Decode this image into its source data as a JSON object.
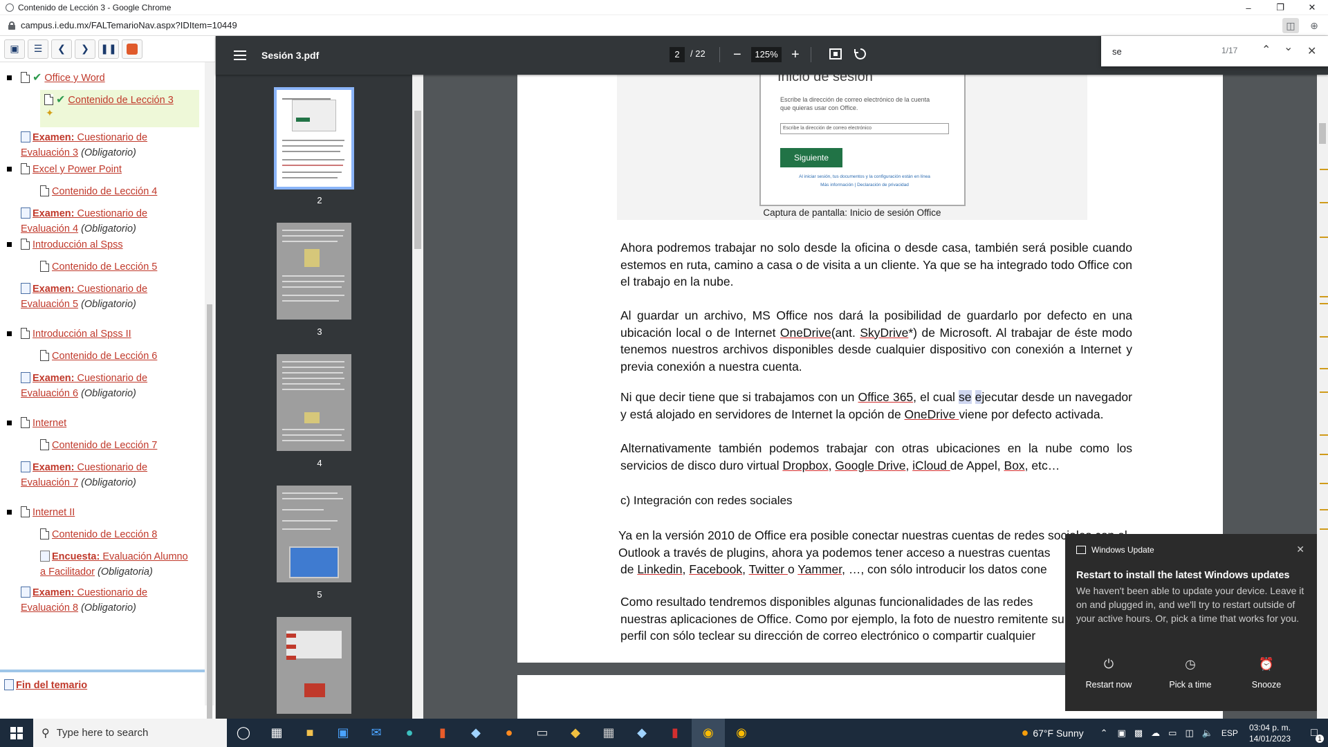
{
  "browser": {
    "window_title": "Contenido de Lección 3 - Google Chrome",
    "url": "campus.i.edu.mx/FALTemarioNav.aspx?IDItem=10449",
    "min_icon": "minimize-icon",
    "restore_icon": "restore-icon",
    "close_icon": "close-icon"
  },
  "left_panel": {
    "items": [
      {
        "title": "Office y Word"
      },
      {
        "title": "Contenido de Lección 3"
      },
      {
        "prefix": "Examen:",
        "rest1": " Cuestionario de",
        "rest2": "Evaluación 3",
        "tag": "(Obligatorio)"
      },
      {
        "title": "Excel y Power Point"
      },
      {
        "title": "Contenido de Lección 4"
      },
      {
        "prefix": "Examen:",
        "rest1": " Cuestionario de",
        "rest2": "Evaluación 4",
        "tag": "(Obligatorio)"
      },
      {
        "title": "Introducción al Spss"
      },
      {
        "title": "Contenido de Lección 5"
      },
      {
        "prefix": "Examen:",
        "rest1": " Cuestionario de",
        "rest2": "Evaluación 5",
        "tag": "(Obligatorio)"
      },
      {
        "title": "Introducción al Spss II"
      },
      {
        "title": "Contenido de Lección 6"
      },
      {
        "prefix": "Examen:",
        "rest1": " Cuestionario de",
        "rest2": "Evaluación 6",
        "tag": "(Obligatorio)"
      },
      {
        "title": "Internet"
      },
      {
        "title": "Contenido de Lección 7"
      },
      {
        "prefix": "Examen:",
        "rest1": " Cuestionario de",
        "rest2": "Evaluación 7",
        "tag": "(Obligatorio)"
      },
      {
        "title": "Internet II"
      },
      {
        "title": "Contenido de Lección 8"
      },
      {
        "prefix": "Encuesta:",
        "rest1": " Evaluación Alumno",
        "rest2": "a Facilitador",
        "tag": "(Obligatoria)"
      },
      {
        "prefix": "Examen:",
        "rest1": " Cuestionario de",
        "rest2": "Evaluación 8",
        "tag": "(Obligatorio)"
      }
    ],
    "fin": "Fin del temario"
  },
  "pdf": {
    "filename": "Sesión 3.pdf",
    "page": "2",
    "total": "/ 22",
    "zoom": "125%",
    "thumbnails": [
      "2",
      "3",
      "4",
      "5"
    ],
    "figure": {
      "heading": "Inicio de sesión",
      "desc": "Escribe la dirección de correo electrónico de la cuenta que quieras usar con Office.",
      "input_placeholder": "Escribe la dirección de correo electrónico",
      "button": "Siguiente",
      "footer1": "Al iniciar sesión, tus documentos y la configuración están en línea",
      "footer2": "Más información  |  Declaración de privacidad",
      "caption": "Captura de pantalla: Inicio de sesión Office"
    },
    "para1": "Ahora podremos trabajar no solo desde la oficina o desde casa, también será posible cuando  estemos en ruta, camino a casa o de visita a un cliente. Ya que se ha integrado todo Office  con el trabajo en la nube.",
    "para2_a": "Al guardar un archivo, MS Office nos dará la posibilidad de guardarlo por defecto en una ubicación local o de Internet ",
    "para2_l1": "OneDrive",
    "para2_b": "(ant. ",
    "para2_l2": "SkyDrive",
    "para2_c": "*) de Microsoft. Al trabajar de éste modo tenemos nuestros archivos disponibles desde cualquier dispositivo con conexión a Internet y previa conexión a nuestra cuenta.",
    "para3_a": "Ni que decir tiene que si trabajamos con un ",
    "para3_l1": "Office 365",
    "para3_b": ", el cual ",
    "para3_hl1": "se",
    "para3_sp": " ",
    "para3_hl2": "e",
    "para3_c": "jecutar desde un navegador y está alojado en servidores de Internet la opción de ",
    "para3_l2": "OneDrive ",
    "para3_d": "viene por defecto  activada.",
    "para4_a": "Alternativamente también podemos trabajar con otras ubicaciones en la nube como los servicios de disco duro virtual ",
    "para4_l1": "Dropbox",
    "para4_comma1": ", ",
    "para4_l2": "Google Drive",
    "para4_comma2": ", ",
    "para4_l3": "iCloud ",
    "para4_b": "de Appel, ",
    "para4_l4": "Box",
    "para4_c": ", etc…",
    "section_c": "c)  Integración con redes sociales",
    "para5": "Ya en la versión 2010 de Office era posible conectar nuestras cuentas de redes sociales con el Outlook a través de plugins, ahora ya podemos tener acceso a nuestras cuentas",
    "para5_b": "de ",
    "para5_l1": "Linkedin",
    "para5_l2": "Facebook",
    "para5_l3": "Twitter ",
    "para5_o": "o ",
    "para5_l4": "Yammer",
    "para5_c": ", …, con sólo introducir los datos cone",
    "para6": "Como resultado tendremos disponibles algunas funcionalidades de las redes nuestras aplicaciones de Office.  Como por ejemplo, la foto de nuestro remitente su perfil con sólo teclear su dirección de correo electrónico o compartir cualquier"
  },
  "find": {
    "query": "se",
    "count": "1/17"
  },
  "toast": {
    "app": "Windows Update",
    "title": "Restart to install the latest Windows updates",
    "body": "We haven't been able to update your device. Leave it on and plugged in, and we'll try to restart outside of your active hours. Or, pick a time that works for you.",
    "actions": [
      "Restart now",
      "Pick a time",
      "Snooze"
    ]
  },
  "taskbar": {
    "search_placeholder": "Type here to search",
    "weather": "67°F  Sunny",
    "lang": "ESP",
    "time": "03:04 p. m.",
    "date": "14/01/2023",
    "notif_count": "1"
  }
}
